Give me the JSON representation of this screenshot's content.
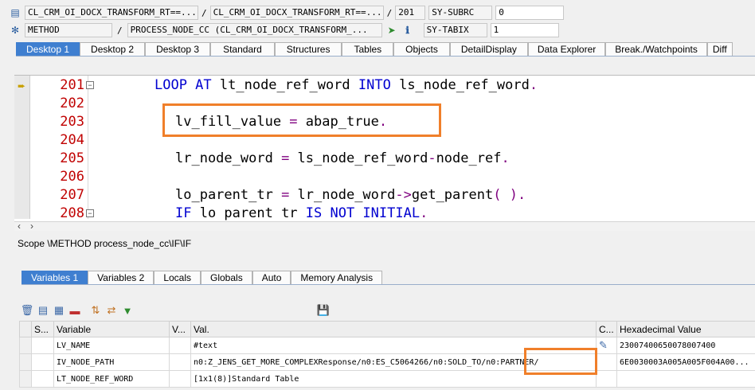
{
  "header": {
    "row1": {
      "program": "CL_CRM_OI_DOCX_TRANSFORM_RT==...",
      "include": "CL_CRM_OI_DOCX_TRANSFORM_RT==...",
      "line": "201",
      "sysfield": "SY-SUBRC",
      "sysvalue": "0"
    },
    "row2": {
      "event_type": "METHOD",
      "event": "PROCESS_NODE_CC (CL_CRM_OI_DOCX_TRANSFORM_...",
      "sysfield": "SY-TABIX",
      "sysvalue": "1"
    }
  },
  "desktop_tabs": [
    "Desktop 1",
    "Desktop 2",
    "Desktop 3",
    "Standard",
    "Structures",
    "Tables",
    "Objects",
    "DetailDisplay",
    "Data Explorer",
    "Break./Watchpoints",
    "Diff"
  ],
  "editor": {
    "line_numbers": [
      "201",
      "202",
      "203",
      "204",
      "205",
      "206",
      "207",
      "208"
    ],
    "code": {
      "l201_kw1": "LOOP AT",
      "l201_v1": " lt_node_ref_word ",
      "l201_kw2": "INTO",
      "l201_v2": " ls_node_ref_word",
      "l201_end": ".",
      "l203_v1": "lv_fill_value ",
      "l203_eq": "=",
      "l203_v2": " abap_true",
      "l203_end": ".",
      "l205_v1": "lr_node_word ",
      "l205_eq": "=",
      "l205_v2": " ls_node_ref_word",
      "l205_dash": "-",
      "l205_v3": "node_ref",
      "l205_end": ".",
      "l207_v1": "lo_parent_tr ",
      "l207_eq": "=",
      "l207_v2": " lr_node_word",
      "l207_arrow": "->",
      "l207_v3": "get_parent",
      "l207_paren": "( )",
      "l207_end": ".",
      "l208_kw1": "IF",
      "l208_v1": " lo parent tr ",
      "l208_kw2": "IS NOT INITIAL",
      "l208_end": "."
    }
  },
  "scope": "Scope \\METHOD process_node_cc\\IF\\IF",
  "variable_tabs": [
    "Variables 1",
    "Variables 2",
    "Locals",
    "Globals",
    "Auto",
    "Memory Analysis"
  ],
  "grid": {
    "columns": [
      "S...",
      "Variable",
      "V...",
      "Val.",
      "C...",
      "Hexadecimal Value"
    ],
    "rows": [
      {
        "variable": "LV_NAME",
        "value": "#text",
        "hex": "23007400650078007400"
      },
      {
        "variable": "IV_NODE_PATH",
        "value": "n0:Z_JENS_GET_MORE_COMPLEXResponse/n0:ES_C5064266/n0:SOLD_TO/n0:PARTNER/",
        "hex": "6E0030003A005A005F004A00..."
      },
      {
        "variable": "LT_NODE_REF_WORD",
        "value": "[1x1(8)]Standard Table",
        "hex": ""
      }
    ]
  },
  "colors": {
    "accent": "#3f7fd0",
    "highlight": "#f07f2a",
    "keyword": "#0000d0",
    "line_number": "#c00000"
  }
}
